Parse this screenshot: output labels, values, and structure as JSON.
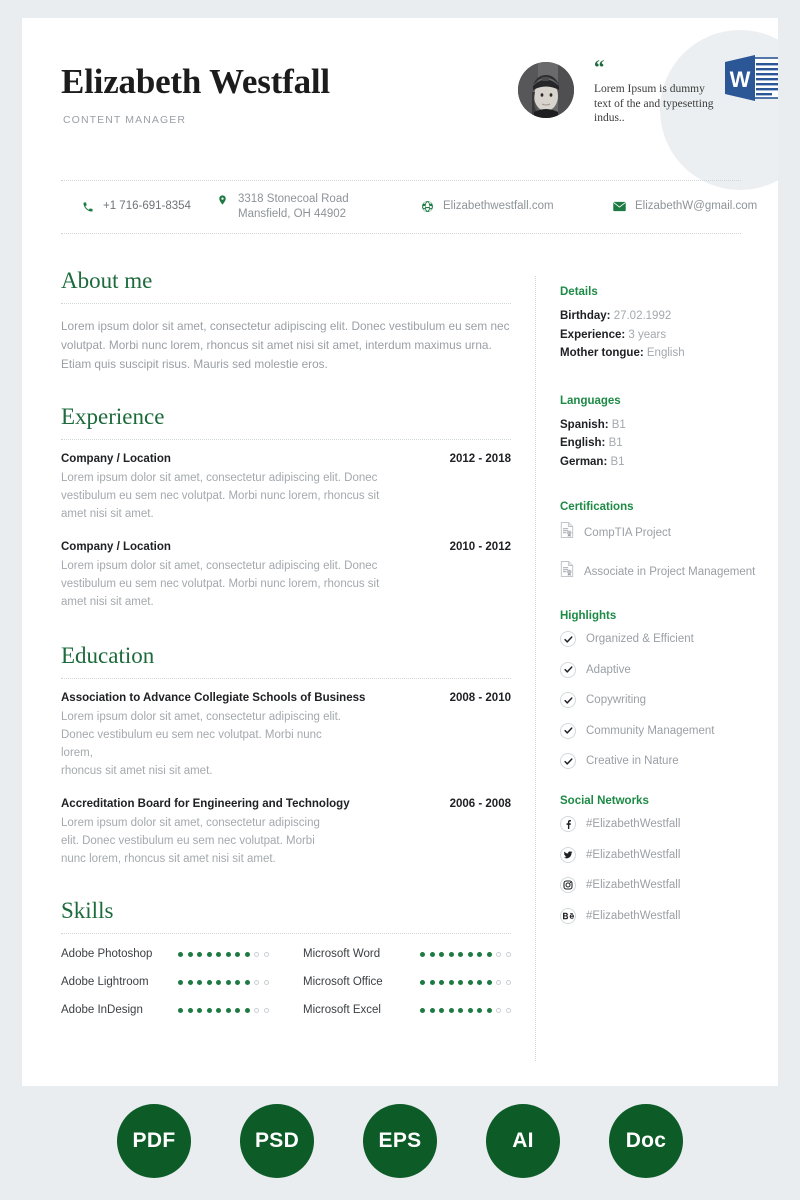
{
  "page": {
    "background_color": "#e9edf0",
    "card_background": "#ffffff",
    "accent_green": "#1d6b3c",
    "accent_green_bright": "#1d8a45",
    "badge_green": "#0d5c28",
    "muted_text": "#9aa0a6"
  },
  "header": {
    "name": "Elizabeth Westfall",
    "role": "CONTENT MANAGER",
    "quote_mark": "“",
    "quote_text": "Lorem Ipsum is dummy text of the and typesetting indus..",
    "avatar_alt": "profile-photo",
    "overlay_icon": "microsoft-word-icon",
    "overlay_icon_letter": "W"
  },
  "contact": [
    {
      "icon": "phone-icon",
      "text": "+1 716-691-8354"
    },
    {
      "icon": "location-pin-icon",
      "text": "3318 Stonecoal Road\nMansfield, OH 44902"
    },
    {
      "icon": "globe-icon",
      "text": "Elizabethwestfall.com"
    },
    {
      "icon": "envelope-icon",
      "text": "ElizabethW@gmail.com"
    }
  ],
  "about": {
    "heading": "About me",
    "text": "Lorem ipsum dolor sit amet, consectetur adipiscing elit. Donec vestibulum eu sem nec volutpat. Morbi nunc lorem, rhoncus sit amet nisi sit amet, interdum maximus urna. Etiam quis suscipit risus. Mauris sed molestie eros."
  },
  "experience": {
    "heading": "Experience",
    "entries": [
      {
        "title": "Company / Location",
        "date": "2012 - 2018",
        "desc": "Lorem ipsum dolor sit amet, consectetur adipiscing elit. Donec\nvestibulum eu sem nec volutpat. Morbi nunc lorem, rhoncus sit\namet nisi sit amet."
      },
      {
        "title": "Company / Location",
        "date": "2010 - 2012",
        "desc": "Lorem ipsum dolor sit amet, consectetur adipiscing elit. Donec\nvestibulum eu sem nec volutpat. Morbi nunc lorem, rhoncus sit\namet nisi sit amet."
      }
    ]
  },
  "education": {
    "heading": "Education",
    "entries": [
      {
        "title": "Association to Advance Collegiate Schools of Business",
        "date": "2008 - 2010",
        "desc": "Lorem ipsum dolor sit amet, consectetur adipiscing elit.\nDonec vestibulum eu sem nec volutpat. Morbi nunc lorem,\nrhoncus sit amet nisi sit amet."
      },
      {
        "title": "Accreditation Board for Engineering and Technology",
        "date": "2006 - 2008",
        "desc": "Lorem ipsum dolor sit amet, consectetur adipiscing\nelit. Donec vestibulum eu sem nec volutpat. Morbi\nnunc lorem, rhoncus sit amet nisi sit amet."
      }
    ]
  },
  "skills": {
    "heading": "Skills",
    "dots_total": 10,
    "items": [
      {
        "name": "Adobe Photoshop",
        "filled": 8
      },
      {
        "name": "Microsoft Word",
        "filled": 8
      },
      {
        "name": "Adobe Lightroom",
        "filled": 8
      },
      {
        "name": "Microsoft Office",
        "filled": 8
      },
      {
        "name": "Adobe InDesign",
        "filled": 8
      },
      {
        "name": "Microsoft Excel",
        "filled": 8
      }
    ]
  },
  "details": {
    "heading": "Details",
    "rows": [
      {
        "key": "Birthday:",
        "value": "27.02.1992"
      },
      {
        "key": "Experience:",
        "value": "3 years"
      },
      {
        "key": "Mother tongue:",
        "value": "English"
      }
    ]
  },
  "languages": {
    "heading": "Languages",
    "rows": [
      {
        "key": "Spanish:",
        "value": "B1"
      },
      {
        "key": "English:",
        "value": "B1"
      },
      {
        "key": "German:",
        "value": "B1"
      }
    ]
  },
  "certifications": {
    "heading": "Certifications",
    "items": [
      {
        "icon": "certificate-document-icon",
        "label": "CompTIA Project"
      },
      {
        "icon": "certificate-document-icon",
        "label": "Associate in Project Management"
      }
    ]
  },
  "highlights": {
    "heading": "Highlights",
    "items": [
      {
        "icon": "check-circle-icon",
        "label": "Organized & Efficient"
      },
      {
        "icon": "check-circle-icon",
        "label": "Adaptive"
      },
      {
        "icon": "check-circle-icon",
        "label": "Copywriting"
      },
      {
        "icon": "check-circle-icon",
        "label": "Community Management"
      },
      {
        "icon": "check-circle-icon",
        "label": "Creative in Nature"
      }
    ]
  },
  "social": {
    "heading": "Social Networks",
    "items": [
      {
        "icon": "facebook-icon",
        "label": "#ElizabethWestfall"
      },
      {
        "icon": "twitter-icon",
        "label": "#ElizabethWestfall"
      },
      {
        "icon": "instagram-icon",
        "label": "#ElizabethWestfall"
      },
      {
        "icon": "behance-icon",
        "label": "#ElizabethWestfall"
      }
    ]
  },
  "footer_badges": [
    {
      "label": "PDF"
    },
    {
      "label": "PSD"
    },
    {
      "label": "EPS"
    },
    {
      "label": "AI"
    },
    {
      "label": "Doc"
    }
  ]
}
